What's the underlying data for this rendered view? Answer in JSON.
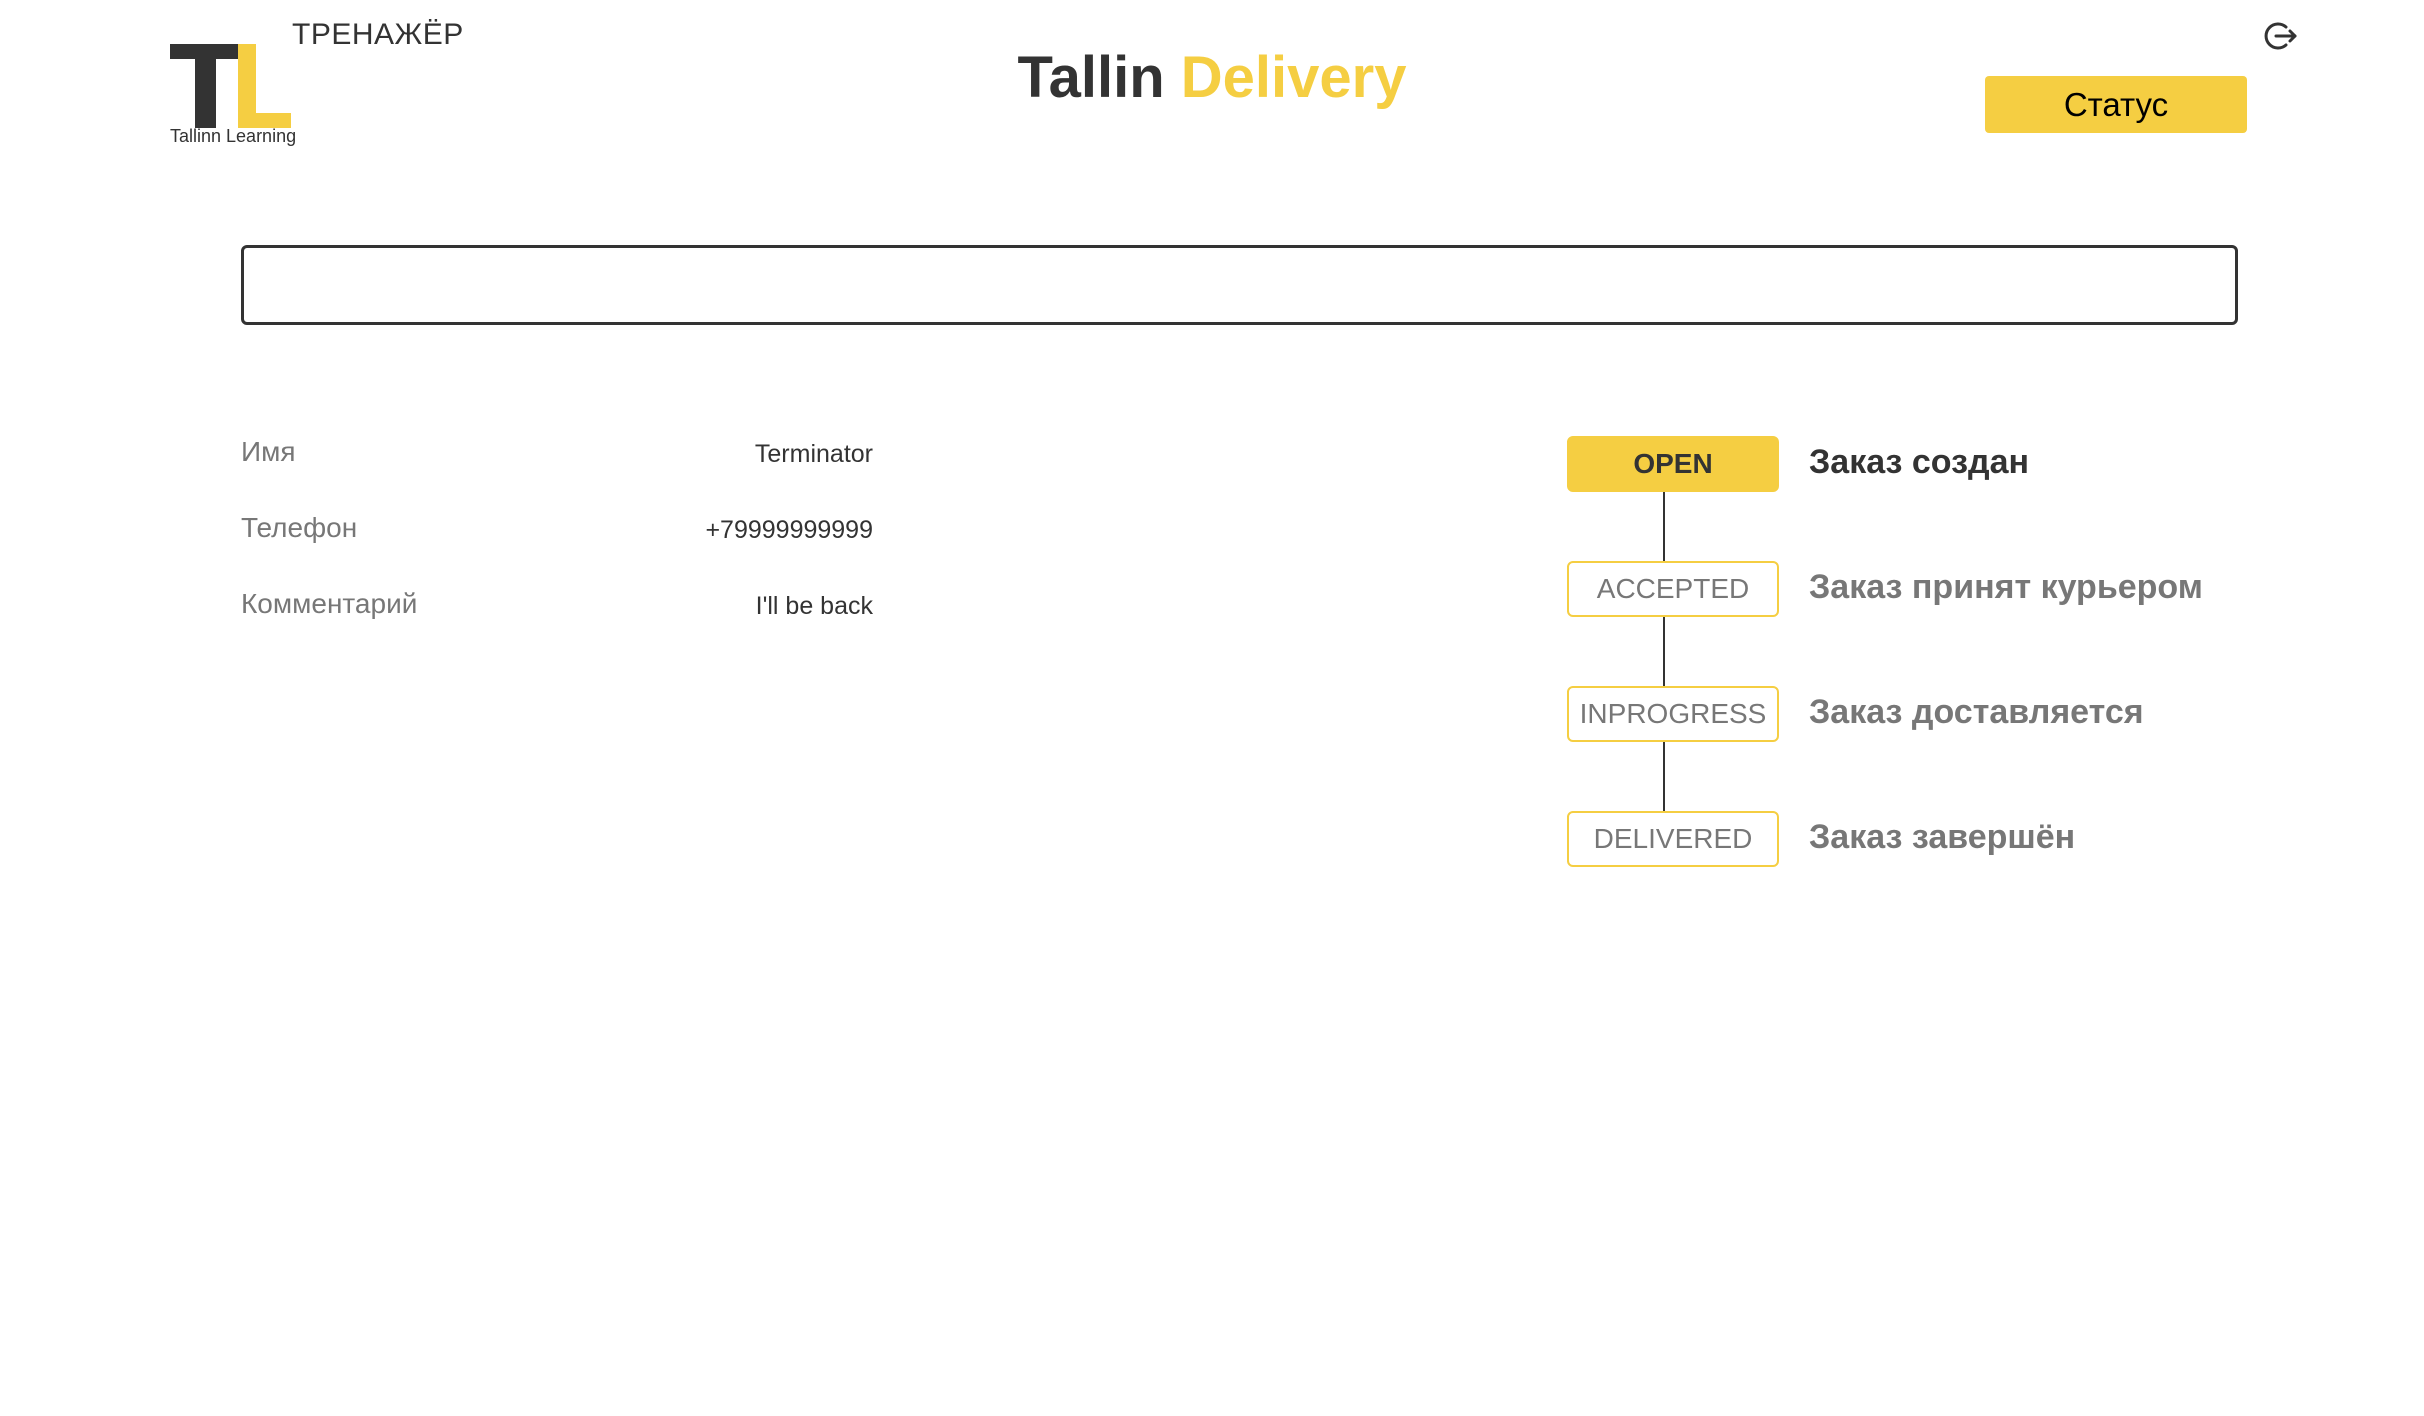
{
  "logo": {
    "letter_t": "T",
    "letter_l": "L",
    "trainer_label": "ТРЕНАЖЁР",
    "subtitle": "Tallinn Learning"
  },
  "header": {
    "title_part1": "Tallin",
    "title_part2": "Delivery",
    "status_button_label": "Статус",
    "logout_icon": "logout-icon"
  },
  "search": {
    "value": "",
    "placeholder": ""
  },
  "order_details": [
    {
      "label": "Имя",
      "value": "Terminator"
    },
    {
      "label": "Телефон",
      "value": "+79999999999"
    },
    {
      "label": "Комментарий",
      "value": "I'll be back"
    }
  ],
  "statuses": [
    {
      "code": "OPEN",
      "description": "Заказ создан",
      "active": true
    },
    {
      "code": "ACCEPTED",
      "description": "Заказ принят курьером",
      "active": false
    },
    {
      "code": "INPROGRESS",
      "description": "Заказ доставляется",
      "active": false
    },
    {
      "code": "DELIVERED",
      "description": "Заказ завершён",
      "active": false
    }
  ],
  "colors": {
    "accent": "#F5CE42",
    "text_dark": "#333333",
    "text_muted": "#777777"
  }
}
